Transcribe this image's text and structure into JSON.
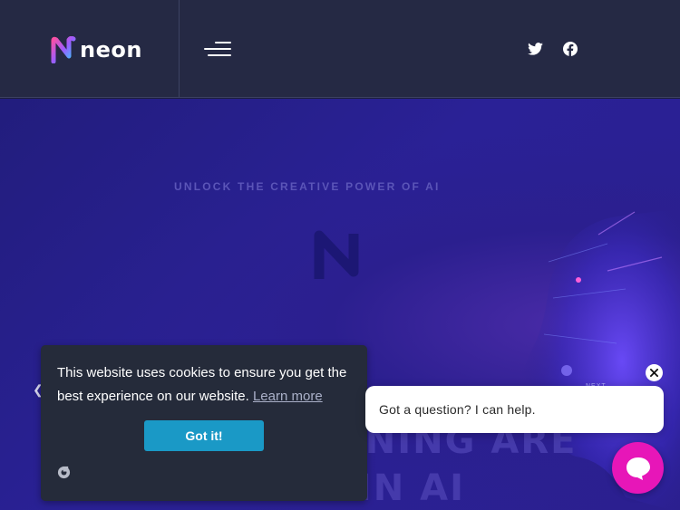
{
  "header": {
    "logo_text": "neon",
    "menu_icon": "hamburger-icon",
    "social": [
      {
        "name": "twitter",
        "icon": "twitter-icon"
      },
      {
        "name": "facebook",
        "icon": "facebook-icon"
      }
    ]
  },
  "hero": {
    "eyebrow": "UNLOCK THE CREATIVE POWER OF AI",
    "heading_line1": "RNING ARE",
    "heading_line2": "EXPERTS IN AI",
    "small_tag": "NEXT",
    "prev_icon": "chevron-left-icon"
  },
  "cookie": {
    "message": "This website uses cookies to ensure you get the best experience on our website.",
    "learn_more": "Learn more",
    "button": "Got it!"
  },
  "chat": {
    "message": "Got a question? I can help.",
    "close_icon": "close-icon",
    "launcher_icon": "chat-bubble-icon"
  },
  "colors": {
    "header_bg": "#252944",
    "hero_bg": "#2a2196",
    "accent_pink": "#e716b8",
    "cookie_button": "#1a99c6",
    "cookie_bg": "#252b3a"
  }
}
